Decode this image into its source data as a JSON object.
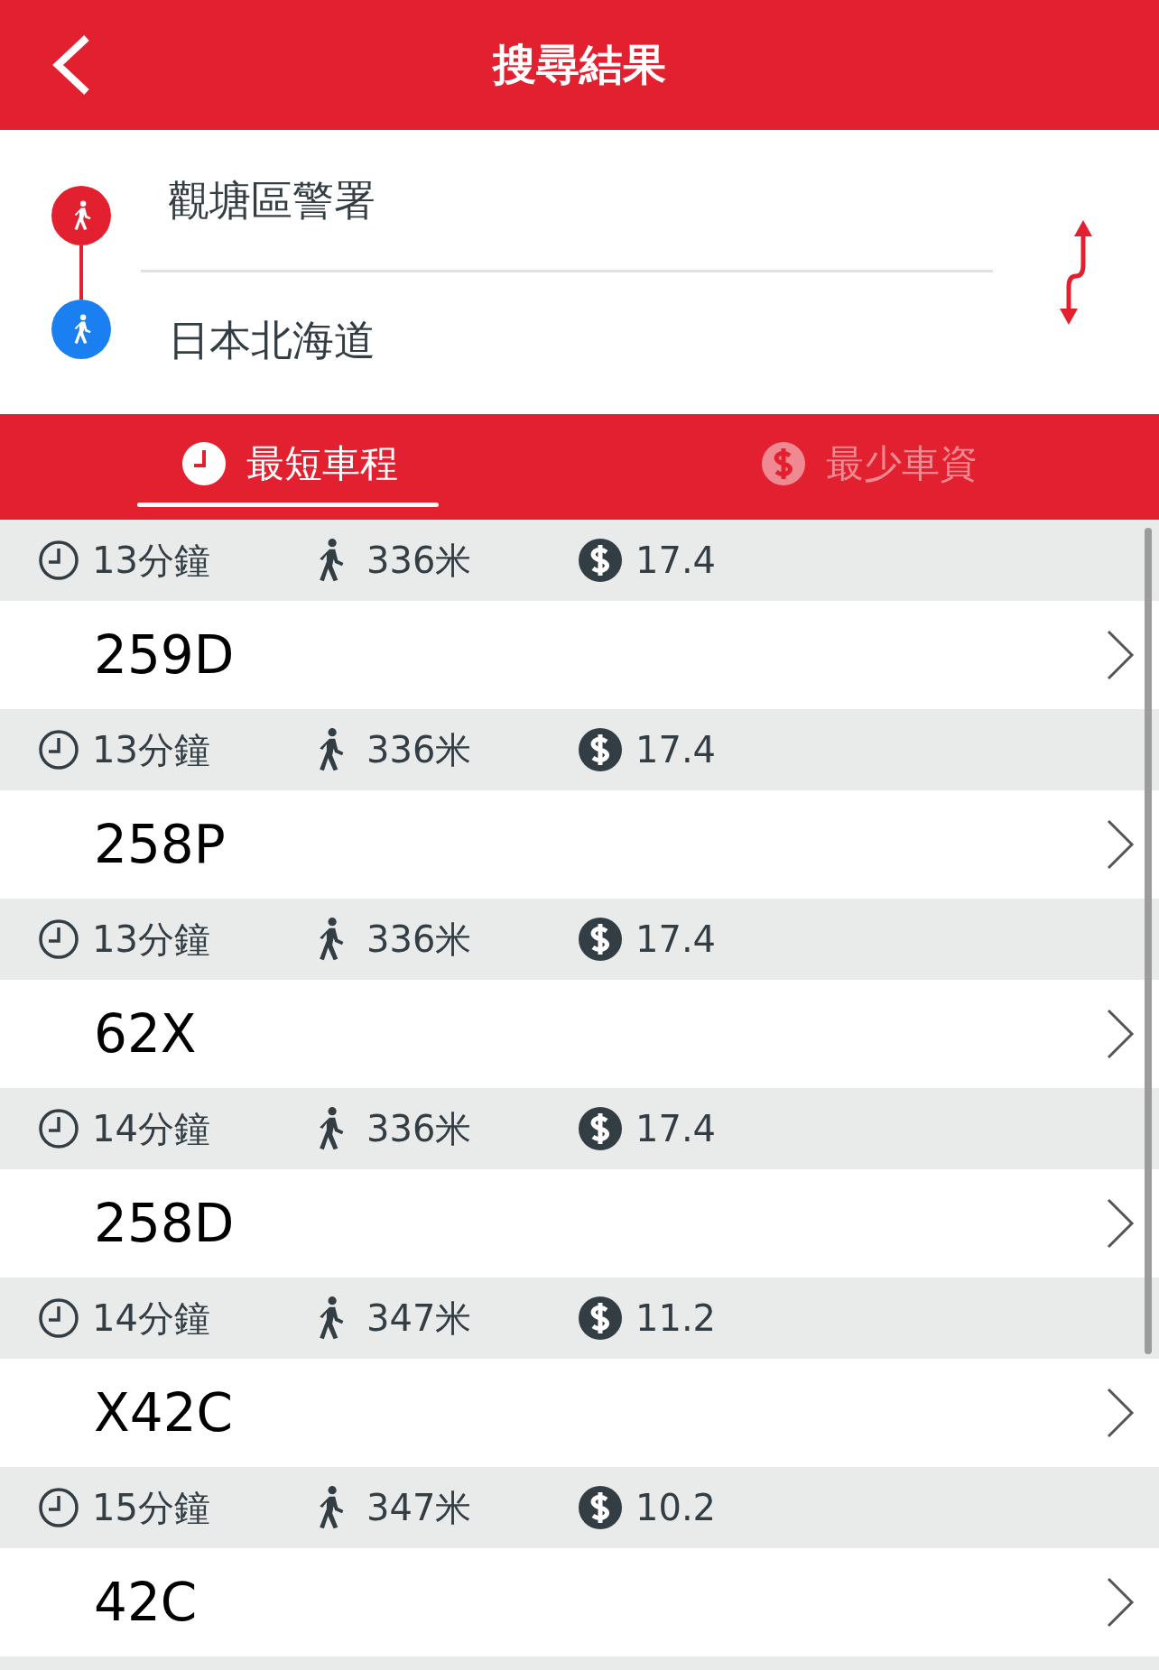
{
  "header": {
    "title": "搜尋結果"
  },
  "route": {
    "origin": "觀塘區警署",
    "destination": "日本北海道"
  },
  "tabs": [
    {
      "kind": "time",
      "label": "最短車程",
      "selected": true
    },
    {
      "kind": "fare",
      "label": "最少車資",
      "selected": false
    }
  ],
  "results": [
    {
      "duration": "13分鐘",
      "walk": "336米",
      "fare": "17.4",
      "route": "259D"
    },
    {
      "duration": "13分鐘",
      "walk": "336米",
      "fare": "17.4",
      "route": "258P"
    },
    {
      "duration": "13分鐘",
      "walk": "336米",
      "fare": "17.4",
      "route": "62X"
    },
    {
      "duration": "14分鐘",
      "walk": "336米",
      "fare": "17.4",
      "route": "258D"
    },
    {
      "duration": "14分鐘",
      "walk": "347米",
      "fare": "11.2",
      "route": "X42C"
    },
    {
      "duration": "15分鐘",
      "walk": "347米",
      "fare": "10.2",
      "route": "42C"
    }
  ]
}
